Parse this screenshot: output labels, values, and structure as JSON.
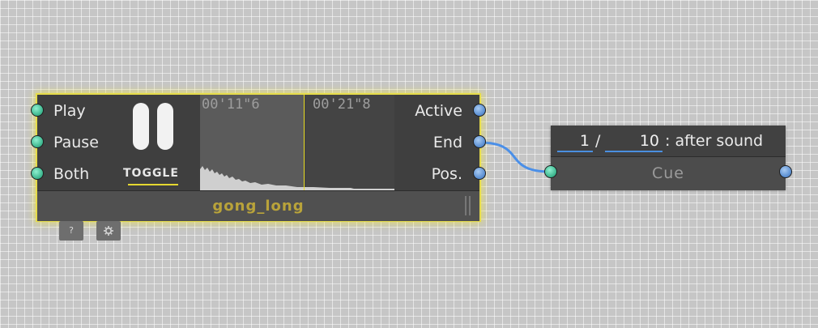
{
  "player": {
    "inputs": [
      "Play",
      "Pause",
      "Both"
    ],
    "outputs": [
      "Active",
      "End",
      "Pos."
    ],
    "toggle_label": "TOGGLE",
    "time_elapsed": "00'11\"6",
    "time_total": "00'21\"8",
    "playhead_fraction": 0.533,
    "sound_name": "gong_long",
    "help_label": "?",
    "icons": [
      "pause-icon",
      "gear-icon"
    ]
  },
  "cue": {
    "current": "1",
    "separator": "/",
    "total": "10",
    "mode": ": after sound",
    "title": "Cue"
  },
  "colors": {
    "accent_yellow": "#e6dc4a",
    "input_port": "#3fb890",
    "output_port": "#5b8fd2",
    "wire": "#4a8fe8"
  }
}
